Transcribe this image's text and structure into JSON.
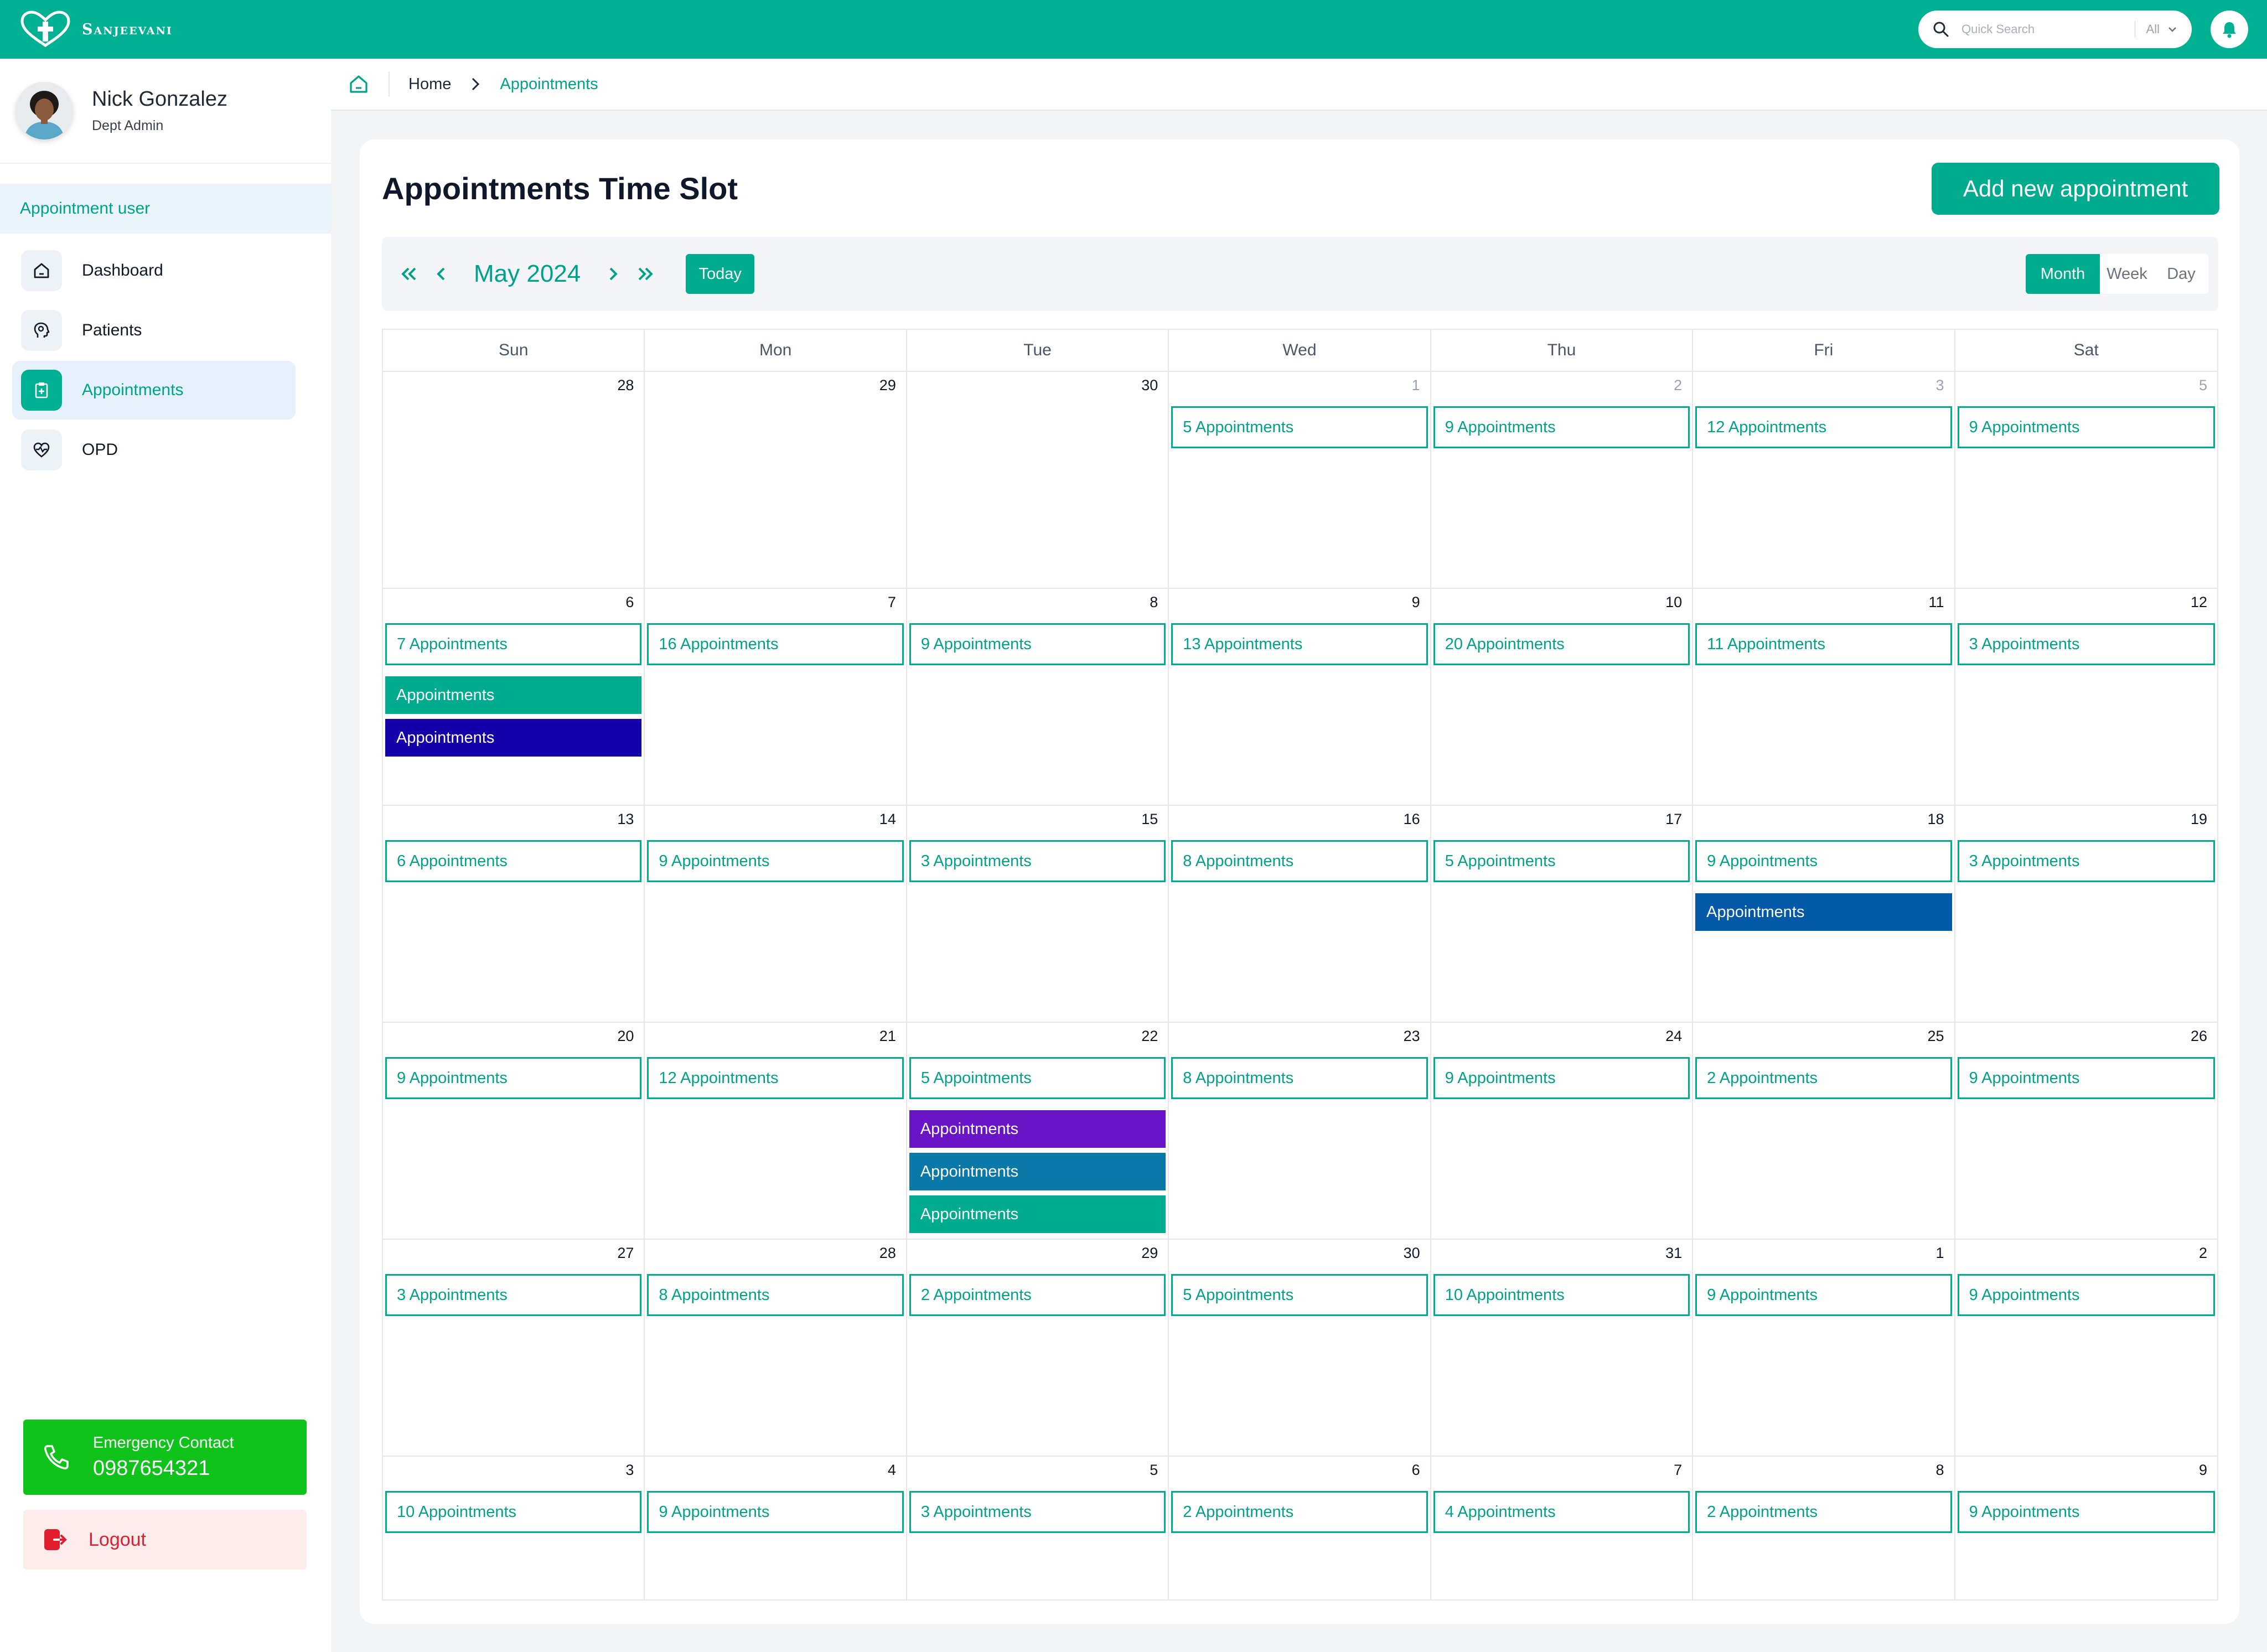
{
  "brand": {
    "name": "Sanjeevani"
  },
  "search": {
    "placeholder": "Quick Search",
    "filter": "All"
  },
  "profile": {
    "name": "Nick Gonzalez",
    "role": "Dept Admin"
  },
  "sidebar": {
    "section_title": "Appointment user",
    "items": [
      {
        "label": "Dashboard",
        "icon": "home-icon",
        "active": false
      },
      {
        "label": "Patients",
        "icon": "head-icon",
        "active": false
      },
      {
        "label": "Appointments",
        "icon": "clipboard-icon",
        "active": true
      },
      {
        "label": "OPD",
        "icon": "heart-pulse-icon",
        "active": false
      }
    ],
    "emergency": {
      "title": "Emergency Contact",
      "number": "0987654321"
    },
    "logout_label": "Logout"
  },
  "breadcrumb": {
    "home": "Home",
    "current": "Appointments"
  },
  "page": {
    "title": "Appointments Time Slot",
    "add_button": "Add new appointment"
  },
  "toolbar": {
    "month_label": "May 2024",
    "today_label": "Today",
    "views": [
      "Month",
      "Week",
      "Day"
    ],
    "active_view": "Month"
  },
  "colors": {
    "brand": "#00b092",
    "accent": "#00ab8e",
    "emergency": "#10c31b",
    "logout": "#e11d2e"
  },
  "calendar": {
    "weekdays": [
      "Sun",
      "Mon",
      "Tue",
      "Wed",
      "Thu",
      "Fri",
      "Sat"
    ],
    "weeks": [
      [
        {
          "day": "28",
          "other": false,
          "box": ""
        },
        {
          "day": "29",
          "other": false,
          "box": ""
        },
        {
          "day": "30",
          "other": false,
          "box": ""
        },
        {
          "day": "1",
          "other": true,
          "box": "5 Appointments"
        },
        {
          "day": "2",
          "other": true,
          "box": "9 Appointments"
        },
        {
          "day": "3",
          "other": true,
          "box": "12 Appointments"
        },
        {
          "day": "5",
          "other": true,
          "box": "9 Appointments"
        }
      ],
      [
        {
          "day": "6",
          "box": "7 Appointments",
          "events": [
            {
              "label": "Appointments",
              "color": "#00ab8e"
            },
            {
              "label": "Appointments",
              "color": "#1400a8"
            }
          ]
        },
        {
          "day": "7",
          "box": "16 Appointments"
        },
        {
          "day": "8",
          "box": "9 Appointments"
        },
        {
          "day": "9",
          "box": "13 Appointments"
        },
        {
          "day": "10",
          "box": "20 Appointments"
        },
        {
          "day": "11",
          "box": "11 Appointments"
        },
        {
          "day": "12",
          "box": "3 Appointments"
        }
      ],
      [
        {
          "day": "13",
          "box": "6 Appointments"
        },
        {
          "day": "14",
          "box": "9 Appointments"
        },
        {
          "day": "15",
          "box": "3 Appointments"
        },
        {
          "day": "16",
          "box": "8 Appointments"
        },
        {
          "day": "17",
          "box": "5 Appointments"
        },
        {
          "day": "18",
          "box": "9 Appointments",
          "events": [
            {
              "label": "Appointments",
              "color": "#0458a8"
            }
          ]
        },
        {
          "day": "19",
          "box": "3 Appointments"
        }
      ],
      [
        {
          "day": "20",
          "box": "9 Appointments"
        },
        {
          "day": "21",
          "box": "12 Appointments"
        },
        {
          "day": "22",
          "box": "5 Appointments",
          "events": [
            {
              "label": "Appointments",
              "color": "#6a14c8"
            },
            {
              "label": "Appointments",
              "color": "#0a78a8"
            },
            {
              "label": "Appointments",
              "color": "#00ab8e"
            }
          ]
        },
        {
          "day": "23",
          "box": "8 Appointments"
        },
        {
          "day": "24",
          "box": "9 Appointments"
        },
        {
          "day": "25",
          "box": "2 Appointments"
        },
        {
          "day": "26",
          "box": "9 Appointments"
        }
      ],
      [
        {
          "day": "27",
          "box": "3 Appointments"
        },
        {
          "day": "28",
          "box": "8 Appointments"
        },
        {
          "day": "29",
          "box": "2 Appointments"
        },
        {
          "day": "30",
          "box": "5 Appointments"
        },
        {
          "day": "31",
          "box": "10 Appointments"
        },
        {
          "day": "1",
          "box": "9 Appointments"
        },
        {
          "day": "2",
          "box": "9 Appointments"
        }
      ],
      [
        {
          "day": "3",
          "box": "10 Appointments"
        },
        {
          "day": "4",
          "box": "9 Appointments"
        },
        {
          "day": "5",
          "box": "3 Appointments"
        },
        {
          "day": "6",
          "box": "2 Appointments"
        },
        {
          "day": "7",
          "box": "4 Appointments"
        },
        {
          "day": "8",
          "box": "2 Appointments"
        },
        {
          "day": "9",
          "box": "9 Appointments"
        }
      ]
    ]
  }
}
